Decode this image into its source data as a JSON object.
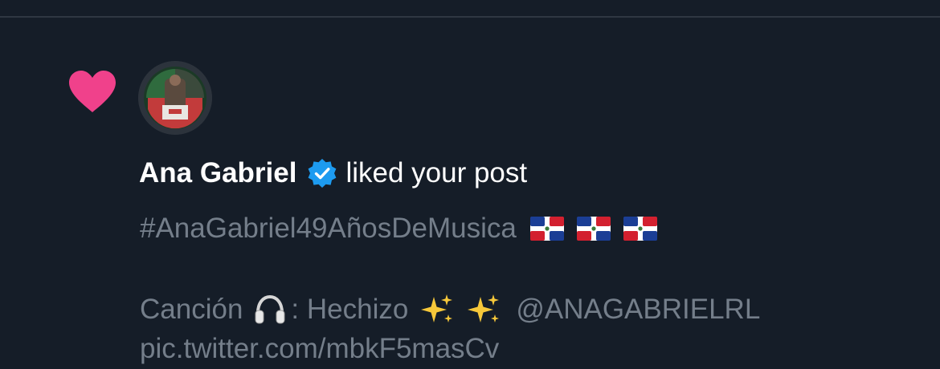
{
  "notification": {
    "type_icon": "heart-icon",
    "user": {
      "avatar_icon": "avatar",
      "name": "Ana Gabriel",
      "verified_icon": "verified-badge-icon"
    },
    "action": "liked your post",
    "post": {
      "hashtag": "#AnaGabriel49AñosDeMusica",
      "hashtag_emojis": [
        "dominican-flag-icon",
        "dominican-flag-icon",
        "dominican-flag-icon"
      ],
      "song_label": "Canción",
      "song_icon": "headphones-icon",
      "song_separator": ": Hechizo",
      "sparkle_icons": [
        "sparkles-icon",
        "sparkles-icon"
      ],
      "mention": "@ANAGABRIELRL",
      "pic_link": "pic.twitter.com/mbkF5masCv"
    }
  },
  "colors": {
    "background": "#151d28",
    "divider": "#2f3742",
    "heart": "#f0418b",
    "verified": "#1d9bf0",
    "name_text": "#ffffff",
    "muted_text": "#747e8a"
  }
}
